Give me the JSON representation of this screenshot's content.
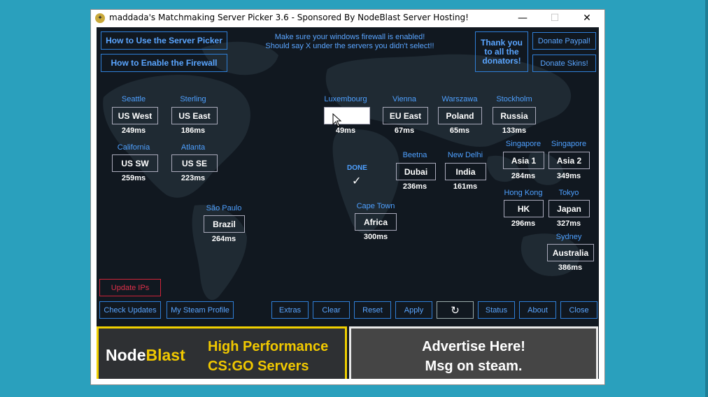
{
  "window": {
    "title": "maddada's Matchmaking Server Picker 3.6 - Sponsored By NodeBlast Server Hosting!",
    "minimize": "—",
    "maximize": "☐",
    "close": "✕"
  },
  "top_buttons": {
    "how_to_use": "How to Use the Server Picker",
    "enable_firewall": "How to Enable the Firewall",
    "thanks": [
      "Thank you",
      "to all the",
      "donators!"
    ],
    "donate_paypal": "Donate Paypal!",
    "donate_skins": "Donate Skins!"
  },
  "notice": {
    "line1": "Make sure your windows firewall is enabled!",
    "line2": "Should say X under the servers you didn't select!!"
  },
  "servers": [
    {
      "city": "Seattle",
      "name": "US West",
      "ping": "249ms"
    },
    {
      "city": "Sterling",
      "name": "US East",
      "ping": "186ms"
    },
    {
      "city": "California",
      "name": "US SW",
      "ping": "259ms"
    },
    {
      "city": "Atlanta",
      "name": "US SE",
      "ping": "223ms"
    },
    {
      "city": "São Paulo",
      "name": "Brazil",
      "ping": "264ms"
    },
    {
      "city": "Luxembourg",
      "name": "",
      "ping": "49ms"
    },
    {
      "city": "Vienna",
      "name": "EU East",
      "ping": "67ms"
    },
    {
      "city": "Warszawa",
      "name": "Poland",
      "ping": "65ms"
    },
    {
      "city": "Stockholm",
      "name": "Russia",
      "ping": "133ms"
    },
    {
      "city": "Beetna",
      "name": "Dubai",
      "ping": "236ms"
    },
    {
      "city": "New Delhi",
      "name": "India",
      "ping": "161ms"
    },
    {
      "city": "Cape Town",
      "name": "Africa",
      "ping": "300ms"
    },
    {
      "city": "Singapore",
      "name": "Asia 1",
      "ping": "284ms"
    },
    {
      "city": "Singapore",
      "name": "Asia 2",
      "ping": "349ms"
    },
    {
      "city": "Hong Kong",
      "name": "HK",
      "ping": "296ms"
    },
    {
      "city": "Tokyo",
      "name": "Japan",
      "ping": "327ms"
    },
    {
      "city": "Sydney",
      "name": "Australia",
      "ping": "386ms"
    }
  ],
  "status": {
    "done": "DONE",
    "check": "✓"
  },
  "bottom_buttons": {
    "update_ips": "Update IPs",
    "check_updates": "Check Updates",
    "steam_profile": "My Steam Profile",
    "extras": "Extras",
    "clear": "Clear",
    "reset": "Reset",
    "apply": "Apply",
    "refresh": "↻",
    "status": "Status",
    "about": "About",
    "close": "Close"
  },
  "banners": {
    "nodeblast_a": "Node",
    "nodeblast_b": "Blast",
    "tagline1": "High Performance",
    "tagline2": "CS:GO Servers",
    "advertise1": "Advertise Here!",
    "advertise2": "Msg on steam."
  },
  "colors": {
    "background": "#2aa0bd",
    "client_bg": "#111820",
    "accent_blue": "#4ea0ff",
    "banner_yellow": "#f0c800"
  }
}
